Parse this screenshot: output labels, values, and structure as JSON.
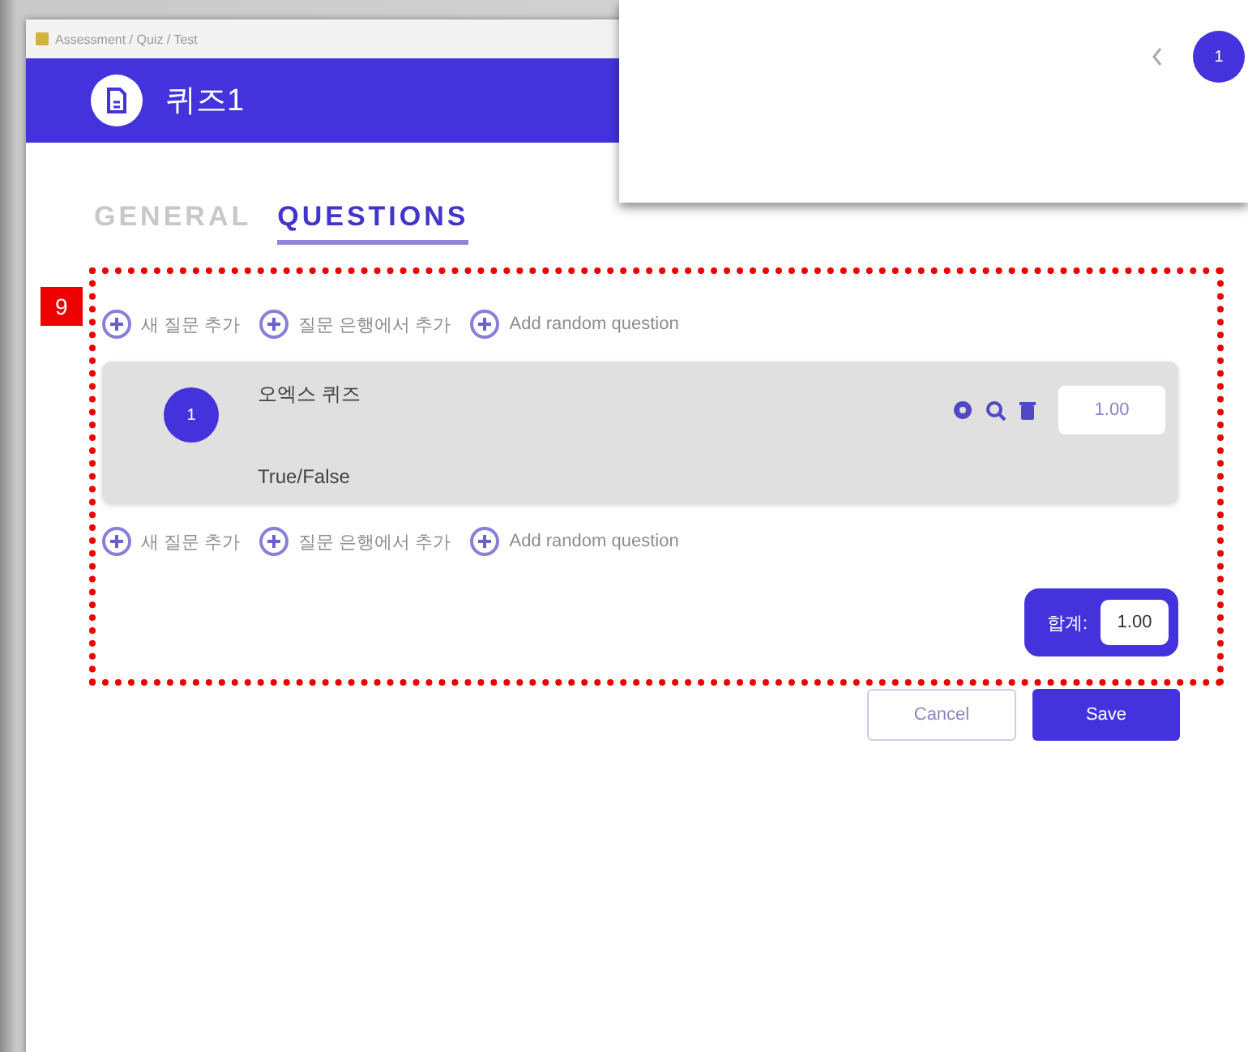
{
  "window": {
    "breadcrumb": "Assessment / Quiz / Test"
  },
  "header": {
    "title": "퀴즈1"
  },
  "tabs": [
    {
      "label": "GENERAL",
      "selected": false
    },
    {
      "label": "QUESTIONS",
      "selected": true
    }
  ],
  "annotation": {
    "number": "9"
  },
  "add_actions_top": [
    "새 질문 추가",
    "질문 은행에서 추가",
    "Add random question"
  ],
  "questions": [
    {
      "number": "1",
      "title": "오엑스 퀴즈",
      "type": "True/False",
      "score": "1.00"
    }
  ],
  "add_actions_bottom": [
    "새 질문 추가",
    "질문 은행에서 추가",
    "Add random question"
  ],
  "total": {
    "label": "합계:",
    "value": "1.00"
  },
  "buttons": {
    "cancel": "Cancel",
    "save": "Save"
  },
  "overlay": {
    "page": "1"
  }
}
